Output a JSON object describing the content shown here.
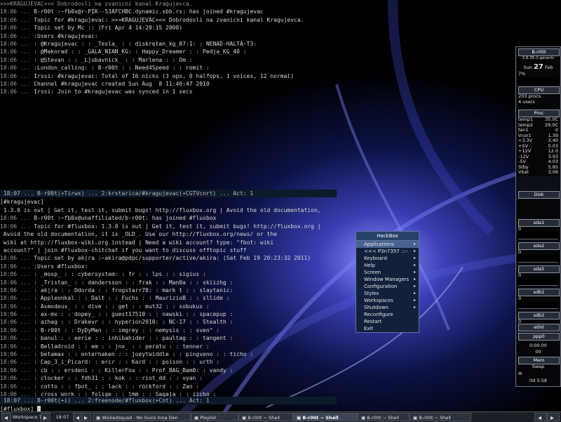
{
  "colors": {
    "accent": "#3b9bd8",
    "nick": "#c060c0",
    "highlight": "#e0a030",
    "menu_bg": "#12203b"
  },
  "terminal_top": {
    "lines": [
      [
        ">>>KRAGUJEVAC<<< Dobrodosli na zvanicni kanal Kragujevca.",
        "",
        "",
        ""
      ],
      [
        "18:06",
        " ... ",
        "B-r00t :~fb0x@r-PIK--53AFCHBC.dynamic.sbb.rs: has joined #kragujevac",
        ""
      ],
      [
        "18:06",
        " ... ",
        "Topic for #kragujevac: >>>KRAGUJEVAC<<< Dobrodosli na zvanicni kanal Kragujevca.",
        ""
      ],
      [
        "18:06",
        " ... ",
        "Topic set by Mc :: (Fri Apr 4 14:20:15 2008)",
        ""
      ],
      [
        "18:06",
        " ... ",
        ":Users #kragujevac:",
        ""
      ],
      [
        "18:06",
        " ... ",
        ": @Kragujevac : : _Tesla_ : : diskretan_kg_87:1: : NENAD-HALTA-T3:",
        ""
      ],
      [
        "18:06",
        " ... ",
        ": @Makorad : : _GALA_NIAN_KG: : Happy_Dreamer : : Pedja_KG_40 :",
        ""
      ],
      [
        "18:06",
        " ... ",
        ": @Stevan : : _Ljubavnick_ : : Marlena : : Om :",
        ""
      ],
      [
        "18:06",
        " ... ",
        ":London_calling: : B-r00t : : Need4Speed : : romit :",
        ""
      ],
      [
        "18:06",
        " ... ",
        "Irssi: #kragujevac: Total of 16 nicks (3 ops, 0 halfops, 1 voices, 12 normal)",
        ""
      ],
      [
        "18:06",
        " ... ",
        "Channel #kragujevac created Sun Aug  8 11:46:47 2010",
        ""
      ],
      [
        "18:06",
        " ... ",
        "Irssi: Join to #kragujevac was synced in 1 secs",
        ""
      ]
    ],
    "statusbar": " 18:07 ... B-r00t(+Tirwx) ... 2:krstarica/#kragujevac(+CGTVcnrt) ... Act: 1 ",
    "prompt": "[#kragujevac] "
  },
  "terminal_bottom": {
    "lines": [
      [
        "",
        " ",
        "1.3.0 is out | Get it, test it, submit bugs! http://fluxbox.org | Avoid the old documentation,",
        ""
      ],
      [
        "18:06",
        " ... ",
        "B-r00t :~fb0x@unaffiliated/b-r00t: has joined #fluxbox",
        ""
      ],
      [
        "18:06",
        " ... ",
        "Topic for #fluxbox: 1.3.0 is out | Get it, test it, submit bugs! http://fluxbox.org |",
        ""
      ],
      [
        "",
        " ",
        "Avoid the old documentation, it is _OLD_. Use our http://fluxbox.org/news/ or the",
        ""
      ],
      [
        "",
        " ",
        "wiki at http://fluxbox-wiki.org instead | Need a wiki account? type: \"fbot: wiki",
        ""
      ],
      [
        "",
        " ",
        "account?\" | join #fluxbox-chitchat if you want to discuss offtopic stuff",
        ""
      ],
      [
        "18:06",
        " ... ",
        "Topic set by ak|ra :~akira@pdpc/supporter/active/akira: (Sat Feb 19 20:23:32 2011)",
        ""
      ],
      [
        "18:06",
        " ... ",
        ":Users #fluxbox:",
        ""
      ],
      [
        "18:06",
        " ... ",
        ": _mosp_ : : cybersystem: : fr : : lps : : sigius :",
        ""
      ],
      [
        "18:06",
        " ... ",
        ": _Tristan_ : : dandersson : : frak : : Man0a : : skiizhg :",
        ""
      ],
      [
        "18:06",
        " ... ",
        ": ak|ra : : Ddorda : : frogstarr78: : mark t : : slaytanic:",
        ""
      ],
      [
        "18:06",
        " ... ",
        ": Appleonkal : : Dalt : : Fuchs : : MaurizioB : : sllide :",
        ""
      ],
      [
        "18:06",
        " ... ",
        ": Asmodeus_ : : dive : : get : : mut32 : : sobukus :",
        ""
      ],
      [
        "18:06",
        " ... ",
        ": ax-mx : : dopey_ : : guest17510 : : nawski : : spacepup :",
        ""
      ],
      [
        "18:06",
        " ... ",
        ": azhag : : Drakevr : : hyperion2010: : NC-17 : : Stealth :",
        ""
      ],
      [
        "18:06",
        " ... ",
        ": B-r00t : : DyDyMan : : imgrey : : nemysis : : sven^ :",
        ""
      ],
      [
        "18:06",
        " ... ",
        ": banul : : eerie : : inhibahider : : paultag : : tangent :",
        ""
      ],
      [
        "18:06",
        " ... ",
        ": Belladroid : : em : : jnx_ : : peratu : : tenner :",
        ""
      ],
      [
        "18:06",
        " ... ",
        ": betamax : : enterhaken : : joeytwiddle : : pingveno : : ticho :",
        ""
      ],
      [
        "18:06",
        " ... ",
        ": Cap_3_i_Picard: : ercr : : Kard : : poison : : urth :",
        ""
      ],
      [
        "18:06",
        " ... ",
        ": cb : : ersdeni : : KillerFox : : Prof_BAG_Bam0: : vandy :",
        ""
      ],
      [
        "18:06",
        " ... ",
        ": clocker : : fdh31 : : kok : : riot_dd : : vyan :",
        ""
      ],
      [
        "18:06",
        " ... ",
        ": cotto : : fbot_ : : lack : : rockford : : Zan :",
        ""
      ],
      [
        "18:06",
        " ... ",
        ": cross_work : : folige : : lmm : : Sagaja : : zicho :",
        ""
      ],
      [
        "18:06",
        " ... ",
        "Irssi: #fluxbox: Total of 80 nicks (0 ops, 0 halfops, 0 voices, 80 normal)",
        ""
      ],
      [
        "18:06",
        " ... ",
        "Home page for #fluxbox: http://fluxbox.sourceforge.net",
        ""
      ],
      [
        "18:06",
        " ... ",
        "Channel #fluxbox created Sun Nov 26 07:42:39 2006",
        ""
      ],
      [
        "18:06",
        " ... ",
        "Irssi: Join to #fluxbox was synced in 2 secs",
        ""
      ]
    ],
    "statusbar": " 18:07 ... B-r00t(+i) ... 2:freenode/#fluxbox(+Cnt) ... Act: 1 ",
    "prompt": "[#fluxbox] "
  },
  "menu": {
    "title": "HackBox",
    "items": [
      {
        "label": "Applications",
        "sub": "true"
      },
      {
        "label": "<<< P3n7357 :::-",
        "sub": "true"
      },
      {
        "label": "Keyboard",
        "sub": "true"
      },
      {
        "label": "Help",
        "sub": "true"
      },
      {
        "label": "Screen",
        "sub": "true"
      },
      {
        "label": "Window Managers",
        "sub": "true"
      },
      {
        "label": "Configuration",
        "sub": "true"
      },
      {
        "label": "Styles",
        "sub": "true"
      },
      {
        "label": "Workspaces",
        "sub": "true"
      },
      {
        "label": "Shutdown",
        "sub": "true"
      },
      {
        "label": "Reconfigure",
        "sub": ""
      },
      {
        "label": "Restart",
        "sub": ""
      },
      {
        "label": "Exit",
        "sub": ""
      }
    ]
  },
  "gkrellm": {
    "host": "B-r00t",
    "kernel": "2.6.35-1-generic",
    "day": "Sun",
    "date": "27",
    "month": "Feb",
    "cpu_label": "CPU",
    "cpu_percent_text": "7%",
    "procs": "203 procs",
    "users": "4 users",
    "proc_label": "Proc",
    "sensors": [
      {
        "k": "temp1",
        "v": "35.0C"
      },
      {
        "k": "temp2",
        "v": "29.0C"
      },
      {
        "k": "fan1",
        "v": "0"
      },
      {
        "k": "Vcor1",
        "v": "1.39"
      },
      {
        "k": "+3.3V",
        "v": "3.40"
      },
      {
        "k": "+5V",
        "v": "5.03"
      },
      {
        "k": "+12V",
        "v": "12.0"
      },
      {
        "k": "-12V",
        "v": "3.93"
      },
      {
        "k": "-5V",
        "v": "4.03"
      },
      {
        "k": "Stby",
        "v": "5.85"
      },
      {
        "k": "Vbat",
        "v": "3.06"
      }
    ],
    "disk_label": "Disk",
    "disks": [
      {
        "label": "sda1",
        "value": "0"
      },
      {
        "label": "sda2",
        "value": "0"
      },
      {
        "label": "sda5",
        "value": "0"
      },
      {
        "label": "sdb1",
        "value": "0"
      },
      {
        "label": "sdb2",
        "value": "0"
      }
    ],
    "net": [
      {
        "label": "eth0",
        "value": "0"
      },
      {
        "label": "ppp0",
        "value": "0"
      }
    ],
    "uptime": "0:00.00",
    "uptime_val": "00",
    "mem_label": "Mem",
    "swap_label": "Swap",
    "bottom": "0d 5:58"
  },
  "taskbar": {
    "workspace": "Workspace 1",
    "clock": "18:07",
    "items": [
      {
        "label": "Wickedsquad - No Guns Inna Den",
        "active": ""
      },
      {
        "label": "Playlist",
        "active": ""
      },
      {
        "label": "B-r00t ~ Shell",
        "active": ""
      },
      {
        "label": "B-r00t ~ Shell",
        "active": "true"
      },
      {
        "label": "B-r00t ~ Shell",
        "active": ""
      },
      {
        "label": "B-r00t ~ Shell",
        "active": ""
      }
    ]
  }
}
